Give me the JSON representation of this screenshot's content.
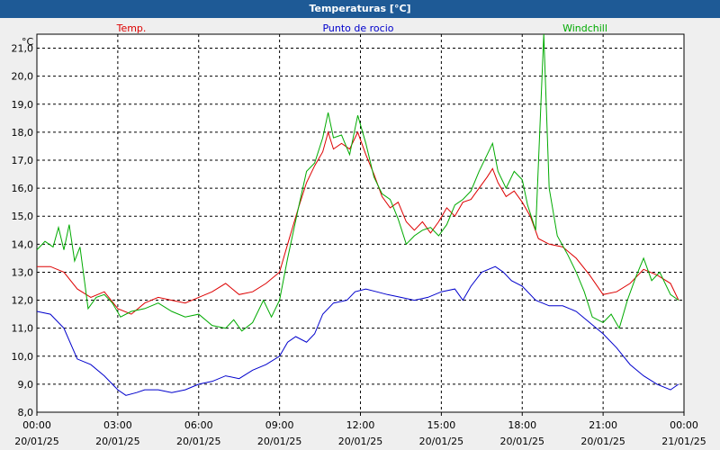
{
  "window": {
    "title": "Temperaturas [°C]"
  },
  "chart_data": {
    "type": "line",
    "title": "",
    "unit_label": "°C",
    "ylim": [
      8.0,
      21.5
    ],
    "yticks": [
      "8,0",
      "9,0",
      "10,0",
      "11,0",
      "12,0",
      "13,0",
      "14,0",
      "15,0",
      "16,0",
      "17,0",
      "18,0",
      "19,0",
      "20,0",
      "21,0"
    ],
    "ytick_values": [
      8,
      9,
      10,
      11,
      12,
      13,
      14,
      15,
      16,
      17,
      18,
      19,
      20,
      21
    ],
    "xlim": [
      0,
      24
    ],
    "xticks": [
      {
        "value": 0,
        "time": "00:00",
        "date": "20/01/25"
      },
      {
        "value": 3,
        "time": "03:00",
        "date": "20/01/25"
      },
      {
        "value": 6,
        "time": "06:00",
        "date": "20/01/25"
      },
      {
        "value": 9,
        "time": "09:00",
        "date": "20/01/25"
      },
      {
        "value": 12,
        "time": "12:00",
        "date": "20/01/25"
      },
      {
        "value": 15,
        "time": "15:00",
        "date": "20/01/25"
      },
      {
        "value": 18,
        "time": "18:00",
        "date": "20/01/25"
      },
      {
        "value": 21,
        "time": "21:00",
        "date": "20/01/25"
      },
      {
        "value": 24,
        "time": "00:00",
        "date": "21/01/25"
      }
    ],
    "grid": true,
    "legend": "top",
    "series": [
      {
        "name": "Temp.",
        "color": "#dd0000",
        "points": [
          [
            0,
            13.2
          ],
          [
            0.5,
            13.2
          ],
          [
            1,
            13.0
          ],
          [
            1.5,
            12.4
          ],
          [
            2,
            12.1
          ],
          [
            2.5,
            12.3
          ],
          [
            3,
            11.7
          ],
          [
            3.5,
            11.5
          ],
          [
            4,
            11.9
          ],
          [
            4.5,
            12.1
          ],
          [
            5,
            12.0
          ],
          [
            5.5,
            11.9
          ],
          [
            6,
            12.1
          ],
          [
            6.5,
            12.3
          ],
          [
            7,
            12.6
          ],
          [
            7.5,
            12.2
          ],
          [
            8,
            12.3
          ],
          [
            8.5,
            12.6
          ],
          [
            9,
            13.0
          ],
          [
            9.3,
            14.0
          ],
          [
            9.7,
            15.3
          ],
          [
            10,
            16.2
          ],
          [
            10.3,
            16.8
          ],
          [
            10.6,
            17.3
          ],
          [
            10.8,
            18.0
          ],
          [
            11,
            17.4
          ],
          [
            11.3,
            17.6
          ],
          [
            11.6,
            17.4
          ],
          [
            11.9,
            18.0
          ],
          [
            12.2,
            17.2
          ],
          [
            12.5,
            16.5
          ],
          [
            12.8,
            15.7
          ],
          [
            13.1,
            15.3
          ],
          [
            13.4,
            15.5
          ],
          [
            13.7,
            14.8
          ],
          [
            14,
            14.5
          ],
          [
            14.3,
            14.8
          ],
          [
            14.6,
            14.4
          ],
          [
            14.9,
            14.8
          ],
          [
            15.2,
            15.3
          ],
          [
            15.5,
            15.0
          ],
          [
            15.8,
            15.5
          ],
          [
            16.1,
            15.6
          ],
          [
            16.4,
            16.0
          ],
          [
            16.7,
            16.4
          ],
          [
            16.9,
            16.7
          ],
          [
            17.1,
            16.2
          ],
          [
            17.4,
            15.7
          ],
          [
            17.7,
            15.9
          ],
          [
            18,
            15.5
          ],
          [
            18.3,
            15.0
          ],
          [
            18.6,
            14.2
          ],
          [
            19,
            14.0
          ],
          [
            19.5,
            13.9
          ],
          [
            20,
            13.5
          ],
          [
            20.5,
            12.9
          ],
          [
            21,
            12.2
          ],
          [
            21.5,
            12.3
          ],
          [
            22,
            12.6
          ],
          [
            22.5,
            13.1
          ],
          [
            23,
            12.9
          ],
          [
            23.5,
            12.6
          ],
          [
            23.8,
            12.0
          ]
        ]
      },
      {
        "name": "Punto de rocio",
        "color": "#0000cc",
        "points": [
          [
            0,
            11.6
          ],
          [
            0.5,
            11.5
          ],
          [
            1,
            11.0
          ],
          [
            1.5,
            9.9
          ],
          [
            2,
            9.7
          ],
          [
            2.5,
            9.3
          ],
          [
            3,
            8.8
          ],
          [
            3.3,
            8.6
          ],
          [
            3.7,
            8.7
          ],
          [
            4,
            8.8
          ],
          [
            4.5,
            8.8
          ],
          [
            5,
            8.7
          ],
          [
            5.5,
            8.8
          ],
          [
            6,
            9.0
          ],
          [
            6.5,
            9.1
          ],
          [
            7,
            9.3
          ],
          [
            7.5,
            9.2
          ],
          [
            8,
            9.5
          ],
          [
            8.5,
            9.7
          ],
          [
            9,
            10.0
          ],
          [
            9.3,
            10.5
          ],
          [
            9.6,
            10.7
          ],
          [
            10,
            10.5
          ],
          [
            10.3,
            10.8
          ],
          [
            10.6,
            11.5
          ],
          [
            11,
            11.9
          ],
          [
            11.5,
            12.0
          ],
          [
            11.8,
            12.3
          ],
          [
            12.2,
            12.4
          ],
          [
            12.6,
            12.3
          ],
          [
            13,
            12.2
          ],
          [
            13.5,
            12.1
          ],
          [
            14,
            12.0
          ],
          [
            14.5,
            12.1
          ],
          [
            15,
            12.3
          ],
          [
            15.5,
            12.4
          ],
          [
            15.8,
            12.0
          ],
          [
            16.1,
            12.5
          ],
          [
            16.5,
            13.0
          ],
          [
            17,
            13.2
          ],
          [
            17.3,
            13.0
          ],
          [
            17.6,
            12.7
          ],
          [
            18,
            12.5
          ],
          [
            18.5,
            12.0
          ],
          [
            19,
            11.8
          ],
          [
            19.5,
            11.8
          ],
          [
            20,
            11.6
          ],
          [
            20.5,
            11.2
          ],
          [
            21,
            10.8
          ],
          [
            21.5,
            10.3
          ],
          [
            22,
            9.7
          ],
          [
            22.5,
            9.3
          ],
          [
            23,
            9.0
          ],
          [
            23.5,
            8.8
          ],
          [
            23.8,
            9.0
          ]
        ]
      },
      {
        "name": "Windchill",
        "color": "#00aa00",
        "points": [
          [
            0,
            13.8
          ],
          [
            0.3,
            14.1
          ],
          [
            0.6,
            13.9
          ],
          [
            0.8,
            14.6
          ],
          [
            1,
            13.8
          ],
          [
            1.2,
            14.7
          ],
          [
            1.4,
            13.4
          ],
          [
            1.6,
            13.9
          ],
          [
            1.9,
            11.7
          ],
          [
            2.2,
            12.1
          ],
          [
            2.5,
            12.2
          ],
          [
            2.8,
            11.9
          ],
          [
            3.1,
            11.4
          ],
          [
            3.5,
            11.6
          ],
          [
            4,
            11.7
          ],
          [
            4.5,
            11.9
          ],
          [
            5,
            11.6
          ],
          [
            5.5,
            11.4
          ],
          [
            6,
            11.5
          ],
          [
            6.5,
            11.1
          ],
          [
            7,
            11.0
          ],
          [
            7.3,
            11.3
          ],
          [
            7.6,
            10.9
          ],
          [
            8,
            11.2
          ],
          [
            8.4,
            12.0
          ],
          [
            8.7,
            11.4
          ],
          [
            9,
            12.0
          ],
          [
            9.3,
            13.5
          ],
          [
            9.7,
            15.3
          ],
          [
            10,
            16.6
          ],
          [
            10.3,
            16.9
          ],
          [
            10.6,
            17.8
          ],
          [
            10.8,
            18.7
          ],
          [
            11,
            17.8
          ],
          [
            11.3,
            17.9
          ],
          [
            11.6,
            17.2
          ],
          [
            11.9,
            18.6
          ],
          [
            12.2,
            17.6
          ],
          [
            12.5,
            16.4
          ],
          [
            12.8,
            15.8
          ],
          [
            13.1,
            15.6
          ],
          [
            13.4,
            14.9
          ],
          [
            13.7,
            14.0
          ],
          [
            14,
            14.3
          ],
          [
            14.3,
            14.5
          ],
          [
            14.6,
            14.6
          ],
          [
            14.9,
            14.3
          ],
          [
            15.2,
            14.7
          ],
          [
            15.5,
            15.4
          ],
          [
            15.8,
            15.6
          ],
          [
            16.1,
            15.9
          ],
          [
            16.4,
            16.6
          ],
          [
            16.7,
            17.2
          ],
          [
            16.9,
            17.6
          ],
          [
            17.1,
            16.6
          ],
          [
            17.4,
            16.0
          ],
          [
            17.7,
            16.6
          ],
          [
            18,
            16.3
          ],
          [
            18.2,
            15.4
          ],
          [
            18.5,
            14.5
          ],
          [
            18.8,
            21.5
          ],
          [
            19,
            16.0
          ],
          [
            19.3,
            14.3
          ],
          [
            19.7,
            13.6
          ],
          [
            20,
            13.0
          ],
          [
            20.3,
            12.3
          ],
          [
            20.6,
            11.4
          ],
          [
            21,
            11.2
          ],
          [
            21.3,
            11.5
          ],
          [
            21.6,
            11.0
          ],
          [
            21.9,
            12.0
          ],
          [
            22.2,
            12.8
          ],
          [
            22.5,
            13.5
          ],
          [
            22.8,
            12.7
          ],
          [
            23.1,
            13.0
          ],
          [
            23.5,
            12.2
          ],
          [
            23.8,
            12.0
          ]
        ]
      }
    ]
  }
}
